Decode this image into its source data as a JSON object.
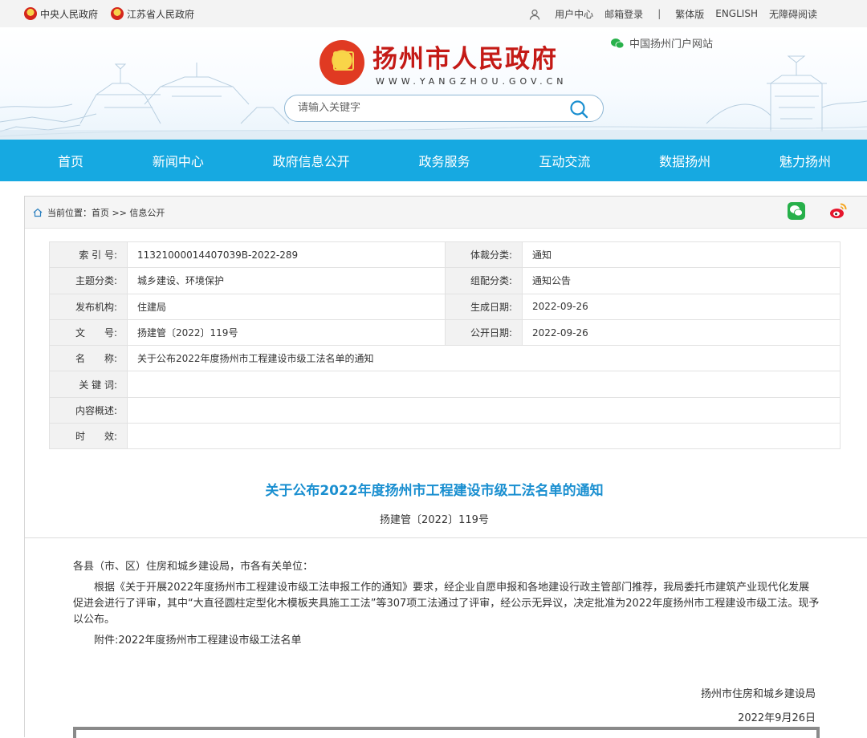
{
  "topbar": {
    "links": [
      "中央人民政府",
      "江苏省人民政府"
    ],
    "user_center": "用户中心",
    "mail_login": "邮箱登录",
    "divider": "|",
    "traditional": "繁体版",
    "english": "ENGLISH",
    "accessible": "无障碍阅读"
  },
  "header": {
    "title": "扬州市人民政府",
    "subtitle": "WWW.YANGZHOU.GOV.CN",
    "portal": "中国扬州门户网站",
    "search_placeholder": "请输入关键字"
  },
  "nav": [
    "首页",
    "新闻中心",
    "政府信息公开",
    "政务服务",
    "互动交流",
    "数据扬州",
    "魅力扬州"
  ],
  "breadcrumb": "当前位置：首页 >> 信息公开",
  "meta": {
    "index_label": "索 引 号:",
    "index_value": "11321000014407039B-2022-289",
    "genre_label": "体裁分类:",
    "genre_value": "通知",
    "topic_label": "主题分类:",
    "topic_value": "城乡建设、环境保护",
    "group_label": "组配分类:",
    "group_value": "通知公告",
    "org_label": "发布机构:",
    "org_value": "住建局",
    "created_label": "生成日期:",
    "created_value": "2022-09-26",
    "docno_label": "文　　号:",
    "docno_value": "扬建管〔2022〕119号",
    "public_label": "公开日期:",
    "public_value": "2022-09-26",
    "name_label": "名　　称:",
    "name_value": "关于公布2022年度扬州市工程建设市级工法名单的通知",
    "keyword_label": "关 键 词:",
    "summary_label": "内容概述:",
    "validity_label": "时　　效:"
  },
  "doc": {
    "title": "关于公布2022年度扬州市工程建设市级工法名单的通知",
    "number": "扬建管〔2022〕119号",
    "salutation": "各县（市、区）住房和城乡建设局，市各有关单位：",
    "paragraph": "根据《关于开展2022年度扬州市工程建设市级工法申报工作的通知》要求，经企业自愿申报和各地建设行政主管部门推荐，我局委托市建筑产业现代化发展促进会进行了评审，其中“大直径圆柱定型化木模板夹具施工工法”等307项工法通过了评审，经公示无异议，决定批准为2022年度扬州市工程建设市级工法。现予以公布。",
    "attachment": "附件:2022年度扬州市工程建设市级工法名单",
    "signer": "扬州市住房和城乡建设局",
    "date": "2022年9月26日"
  },
  "colors": {
    "nav_bg": "#16a9e1",
    "title_red": "#c41a16",
    "doc_title_blue": "#1a8fd0"
  }
}
